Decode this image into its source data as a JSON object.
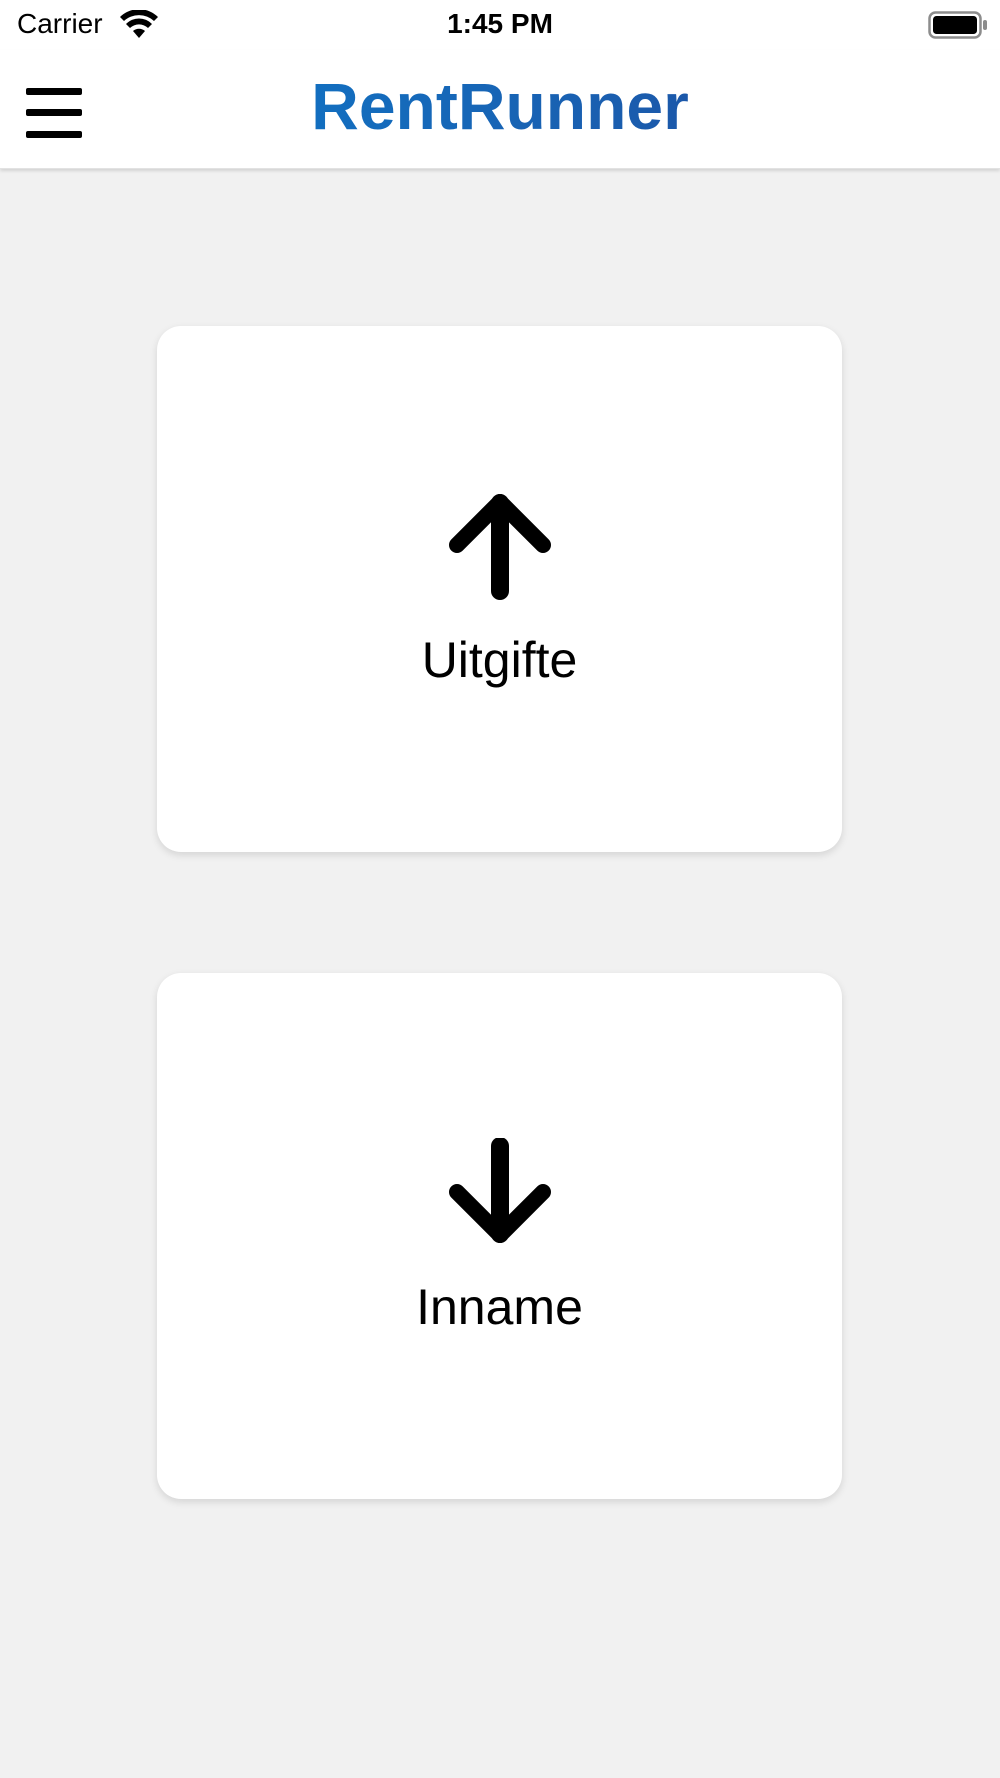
{
  "status_bar": {
    "carrier": "Carrier",
    "time": "1:45 PM",
    "wifi_icon": "wifi-icon",
    "battery_icon": "battery-icon"
  },
  "nav_bar": {
    "menu_icon": "hamburger-menu-icon",
    "logo_text": "RentRunner",
    "logo_colors": [
      "#0a7fd0",
      "#1f3f94"
    ]
  },
  "cards": [
    {
      "label": "Uitgifte",
      "icon": "arrow-up-icon"
    },
    {
      "label": "Inname",
      "icon": "arrow-down-icon"
    }
  ],
  "colors": {
    "background": "#f1f1f1",
    "card": "#ffffff",
    "text": "#000000"
  }
}
